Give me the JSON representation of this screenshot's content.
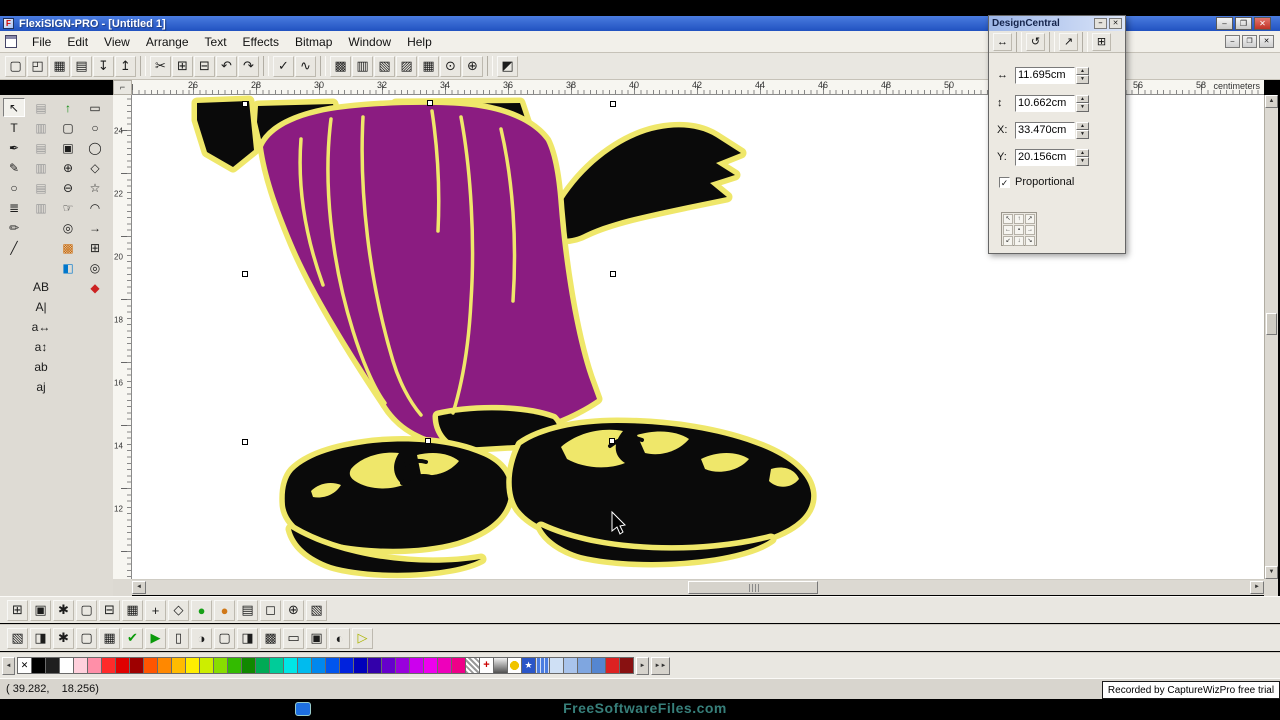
{
  "window": {
    "title": "FlexiSIGN-PRO - [Untitled 1]",
    "app_icon_letter": "F",
    "controls": {
      "minimize": "–",
      "maximize": "❐",
      "close": "✕"
    }
  },
  "menu": {
    "items": [
      "File",
      "Edit",
      "View",
      "Arrange",
      "Text",
      "Effects",
      "Bitmap",
      "Window",
      "Help"
    ],
    "mdi_controls": {
      "minimize": "–",
      "restore": "❐",
      "close": "✕"
    }
  },
  "top_toolbar": {
    "icons": [
      {
        "n": "new-document",
        "g": "▢"
      },
      {
        "n": "open-file",
        "g": "◰"
      },
      {
        "n": "save-file",
        "g": "▦"
      },
      {
        "n": "print",
        "g": "▤"
      },
      {
        "n": "import",
        "g": "↧"
      },
      {
        "n": "export",
        "g": "↥"
      },
      "sep",
      {
        "n": "cut",
        "g": "✂"
      },
      {
        "n": "copy",
        "g": "⊞"
      },
      {
        "n": "paste",
        "g": "⊟"
      },
      {
        "n": "undo",
        "g": "↶"
      },
      {
        "n": "redo",
        "g": "↷"
      },
      "sep",
      {
        "n": "spell-check",
        "g": "✓"
      },
      {
        "n": "measure",
        "g": "∿"
      },
      "sep",
      {
        "n": "show-grid",
        "g": "▩"
      },
      {
        "n": "show-guides",
        "g": "▥"
      },
      {
        "n": "snap-toggle",
        "g": "▧"
      },
      {
        "n": "wireframe-view",
        "g": "▨"
      },
      {
        "n": "show-fills",
        "g": "▦"
      },
      {
        "n": "preview",
        "g": "⊙"
      },
      {
        "n": "zoom",
        "g": "⊕"
      },
      "sep",
      {
        "n": "color-specs",
        "g": "◩"
      }
    ]
  },
  "left_tools": {
    "col1": [
      {
        "n": "select-tool",
        "g": "↖",
        "p": 1
      },
      {
        "n": "text-tool",
        "g": "T"
      },
      {
        "n": "bezier-tool",
        "g": "✒"
      },
      {
        "n": "freehand-tool",
        "g": "✎"
      },
      {
        "n": "ellipse-tool",
        "g": "○"
      },
      {
        "n": "pattern-tool",
        "g": "≣"
      },
      {
        "n": "pen-tool",
        "g": "✏"
      },
      {
        "n": "knife-tool",
        "g": "╱"
      }
    ],
    "col2": [
      {
        "n": "align-horizontal",
        "g": "▤",
        "c": "#9a9a9a"
      },
      {
        "n": "align-vertical",
        "g": "▥",
        "c": "#9a9a9a"
      },
      {
        "n": "distribute-rows",
        "g": "▤",
        "c": "#9a9a9a"
      },
      {
        "n": "distribute-cols",
        "g": "▥",
        "c": "#9a9a9a"
      },
      {
        "n": "spacing-even",
        "g": "▤",
        "c": "#9a9a9a"
      },
      {
        "n": "spacing-custom",
        "g": "▥",
        "c": "#9a9a9a"
      },
      {
        "sp": 58
      },
      {
        "n": "kerning-ab",
        "g": "AB"
      },
      {
        "n": "kerning-cursor",
        "g": "A|"
      },
      {
        "n": "tracking-horizontal",
        "g": "a↔"
      },
      {
        "n": "tracking-vertical",
        "g": "a↕"
      },
      {
        "n": "lowercase-pair",
        "g": "ab"
      },
      {
        "n": "script-pair",
        "g": "aj"
      }
    ],
    "col3": [
      {
        "n": "promote-arrow",
        "g": "↑",
        "c": "#0a8a0a"
      },
      {
        "n": "page-view",
        "g": "▢"
      },
      {
        "n": "pages-view",
        "g": "▣"
      },
      {
        "n": "zoom-in-tool",
        "g": "⊕"
      },
      {
        "n": "zoom-out-tool",
        "g": "⊖"
      },
      {
        "n": "pan-hand-tool",
        "g": "☞"
      },
      {
        "n": "zoom-to-page",
        "g": "◎"
      },
      {
        "n": "fill-swatches",
        "g": "▩",
        "c": "#cc6600"
      },
      {
        "n": "color-swatch-tool",
        "g": "◧",
        "c": "#0077cc"
      }
    ],
    "col4": [
      {
        "n": "rectangle-tool",
        "g": "▭"
      },
      {
        "n": "oval-tool",
        "g": "○"
      },
      {
        "n": "circle-tool",
        "g": "◯"
      },
      {
        "n": "polygon-tool",
        "g": "◇"
      },
      {
        "n": "star-tool",
        "g": "☆"
      },
      {
        "n": "arc-tool",
        "g": "◠"
      },
      {
        "n": "arrow-shape-tool",
        "g": "→"
      },
      {
        "n": "grid-shape-tool",
        "g": "⊞"
      },
      {
        "n": "registration-mark-tool",
        "g": "◎"
      },
      {
        "n": "diamond-tool",
        "g": "◆",
        "c": "#cc2222"
      }
    ]
  },
  "bottom_toolbar1": {
    "icons": [
      {
        "n": "design-central-toggle",
        "g": "⊞"
      },
      {
        "n": "fill-editor",
        "g": "▣"
      },
      {
        "n": "effects-menu",
        "g": "✱"
      },
      {
        "n": "new-layer",
        "g": "▢"
      },
      {
        "n": "merge-objects",
        "g": "⊟"
      },
      {
        "n": "grid-toggle",
        "g": "▦"
      },
      {
        "n": "crosshair",
        "g": "+"
      },
      {
        "n": "snap-magnet",
        "g": "◇"
      },
      {
        "n": "status-green",
        "g": "●",
        "c": "#18a018"
      },
      {
        "n": "status-orange",
        "g": "●",
        "c": "#d07818"
      },
      {
        "n": "rows-view",
        "g": "▤"
      },
      {
        "n": "blank-slot",
        "g": "◻"
      },
      {
        "n": "add-object",
        "g": "⊕"
      },
      {
        "n": "hatch-fill",
        "g": "▧"
      }
    ]
  },
  "bottom_toolbar2": {
    "icons": [
      {
        "n": "select-mode",
        "g": "▧"
      },
      {
        "n": "mask-mode",
        "g": "◨"
      },
      {
        "n": "sparkle-effect",
        "g": "✱"
      },
      {
        "n": "page-setup",
        "g": "▢"
      },
      {
        "n": "grid-setup",
        "g": "▦"
      },
      {
        "n": "confirm-check",
        "g": "✔",
        "c": "#0a9a0a"
      },
      {
        "n": "play-preview",
        "g": "▶",
        "c": "#0a9a0a"
      },
      {
        "n": "frame-tool",
        "g": "▯"
      },
      {
        "n": "contrast-tool",
        "g": "◑"
      },
      {
        "n": "document-tool",
        "g": "▢"
      },
      {
        "n": "half-fill-tool",
        "g": "◨"
      },
      {
        "n": "dense-grid",
        "g": "▩"
      },
      {
        "n": "bar-object",
        "g": "▭"
      },
      {
        "n": "filled-object",
        "g": "▣"
      },
      {
        "n": "half-circle-tool",
        "g": "◐"
      },
      {
        "n": "yellow-arrow",
        "g": "▷",
        "c": "#aab400"
      }
    ]
  },
  "rulers": {
    "horizontal_numbers": [
      26,
      28,
      30,
      32,
      34,
      36,
      38,
      40,
      42,
      44,
      46,
      48,
      50,
      52,
      54,
      56,
      58
    ],
    "vertical_numbers": [
      24,
      22,
      20,
      18,
      16,
      14,
      12
    ],
    "unit_label": "centimeters",
    "corner_icon": "⌐"
  },
  "design_central": {
    "title": "DesignCentral",
    "buttons": {
      "rollup": "–",
      "close": "✕"
    },
    "toolbar": [
      {
        "n": "resize-mode",
        "g": "↔"
      },
      "sep",
      {
        "n": "rotate-mode",
        "g": "↺"
      },
      "sep",
      {
        "n": "shear-mode",
        "g": "↗"
      },
      "sep",
      {
        "n": "distort-mode",
        "g": "⊞"
      }
    ],
    "width_icon": "↔",
    "width_value": "11.695cm",
    "height_icon": "↕",
    "height_value": "10.662cm",
    "x_label": "X:",
    "x_value": "33.470cm",
    "y_label": "Y:",
    "y_value": "20.156cm",
    "proportional_label": "Proportional",
    "proportional_checked": "checked",
    "checkmark": "✓",
    "refgrid": [
      "↖",
      "↑",
      "↗",
      "←",
      "▪",
      "→",
      "↙",
      "↓",
      "↘"
    ]
  },
  "palette": {
    "left_arrow": "◄",
    "right_arrow": "►",
    "right_arrow2": "►►",
    "colors": [
      "X",
      "#000000",
      "#1f1f1f",
      "#ffffff",
      "#ffd0dc",
      "#ff8fa8",
      "#ff2a2a",
      "#e00000",
      "#9e0000",
      "#ff5500",
      "#ff8800",
      "#ffbb00",
      "#ffee00",
      "#ccee00",
      "#88dd00",
      "#33bb00",
      "#118800",
      "#00aa55",
      "#00cc99",
      "#00e6e6",
      "#00bbee",
      "#0088ee",
      "#0055ee",
      "#0022dd",
      "#0000bb",
      "#3300aa",
      "#6600cc",
      "#9900dd",
      "#cc00ee",
      "#ee00ee",
      "#ee00bb",
      "#ee0088",
      "CHK",
      "CRS",
      "GRD",
      "DOT",
      "STAR",
      "NET",
      "#cfe0f5",
      "#a9c4ec",
      "#7fa6e0",
      "#5586d0",
      "#dd2222",
      "#881111"
    ]
  },
  "scrollbars": {
    "up": "▲",
    "down": "▼",
    "left": "◄",
    "right": "►"
  },
  "status_bar": {
    "coordinates": "( 39.282,    18.256)"
  },
  "recorder_badge": "Recorded by CaptureWizPro free trial",
  "watermark": "FreeSoftwareFiles.com",
  "artwork_colors": {
    "outline_yellow": "#efe76a",
    "pants_purple": "#8b1c81",
    "ink_black": "#0a0a0a"
  }
}
